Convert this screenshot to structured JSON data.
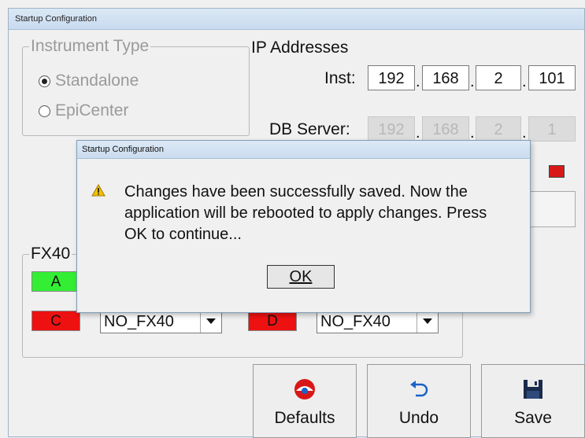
{
  "window": {
    "title": "Startup Configuration"
  },
  "instrument_type": {
    "legend": "Instrument Type",
    "options": [
      {
        "label": "Standalone",
        "selected": true
      },
      {
        "label": "EpiCenter",
        "selected": false
      }
    ]
  },
  "ip": {
    "legend": "IP Addresses",
    "inst_label": "Inst:",
    "inst": [
      "192",
      "168",
      "2",
      "101"
    ],
    "db_label": "DB Server:",
    "db": [
      "192",
      "168",
      "2",
      "1"
    ]
  },
  "fx40": {
    "legend": "FX40",
    "slots": [
      {
        "label": "A",
        "color": "#33ee33"
      },
      {
        "label": "C",
        "color": "#ee1111",
        "value": "NO_FX40"
      },
      {
        "label": "D",
        "color": "#ee1111",
        "value": "NO_FX40"
      }
    ]
  },
  "buttons": {
    "defaults": "Defaults",
    "undo": "Undo",
    "save": "Save"
  },
  "dialog": {
    "title": "Startup Configuration",
    "message": "Changes have been successfully saved. Now the application will be rebooted to apply changes. Press OK to continue...",
    "ok": "OK"
  },
  "colors": {
    "status_red": "#d81818",
    "accent": "#1a62c8"
  }
}
